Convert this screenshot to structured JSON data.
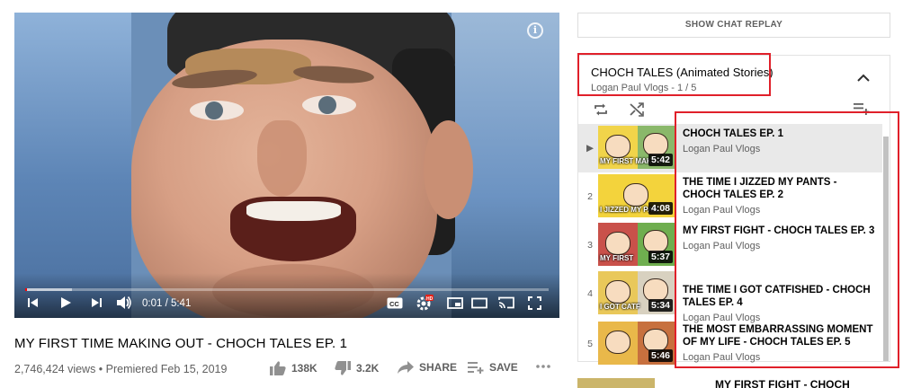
{
  "player": {
    "current_time": "0:01 / 5:41",
    "progress": 0.003,
    "buffered": 0.09
  },
  "video": {
    "title": "MY FIRST TIME MAKING OUT - CHOCH TALES EP. 1",
    "meta": "2,746,424 views • Premiered Feb 15, 2019",
    "likes": "138K",
    "dislikes": "3.2K",
    "share_label": "SHARE",
    "save_label": "SAVE"
  },
  "chat": {
    "replay_label": "SHOW CHAT REPLAY"
  },
  "playlist": {
    "title": "CHOCH TALES (Animated Stories)",
    "subtitle": "Logan Paul Vlogs - 1 / 5",
    "items": [
      {
        "index": "▶",
        "title": "CHOCH TALES EP. 1",
        "channel": "Logan Paul Vlogs",
        "duration": "5:42",
        "thumb_text": "MY FIRST MAKEO"
      },
      {
        "index": "2",
        "title": "THE TIME I JIZZED MY PANTS - CHOCH TALES EP. 2",
        "channel": "Logan Paul Vlogs",
        "duration": "4:08",
        "thumb_text": "I JIZZED MY PAN"
      },
      {
        "index": "3",
        "title": "MY FIRST FIGHT - CHOCH TALES EP. 3",
        "channel": "Logan Paul Vlogs",
        "duration": "5:37",
        "thumb_text": "MY FIRST"
      },
      {
        "index": "4",
        "title": "THE TIME I GOT CATFISHED - CHOCH TALES EP. 4",
        "channel": "Logan Paul Vlogs",
        "duration": "5:34",
        "thumb_text": "I GOT CATF"
      },
      {
        "index": "5",
        "title": "THE MOST EMBARRASSING MOMENT OF MY LIFE - CHOCH TALES EP. 5",
        "channel": "Logan Paul Vlogs",
        "duration": "5:46",
        "thumb_text": ""
      }
    ]
  },
  "next_up": {
    "title": "MY FIRST FIGHT - CHOCH"
  },
  "colors": {
    "highlight": "#e0202a",
    "progress": "#ff0000",
    "text_secondary": "#606060"
  }
}
